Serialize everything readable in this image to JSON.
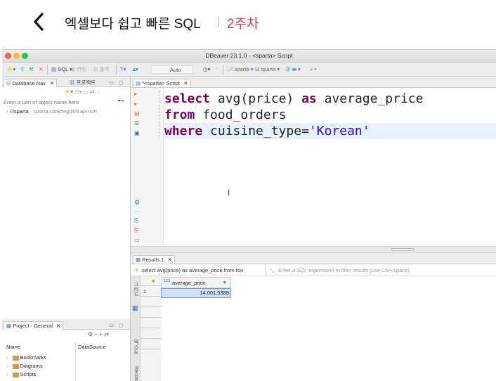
{
  "course": {
    "back_icon": "chevron-left-icon",
    "title": "엑셀보다 쉽고 빠른 SQL",
    "week": "2주차",
    "week_color": "#e8344e"
  },
  "window": {
    "title": "DBeaver 23.1.0 - <sparta> Script",
    "traffic_lights": [
      "#fe5f57",
      "#febc2e",
      "#28c840"
    ]
  },
  "toolbar": {
    "sql_label": "SQL",
    "commit_label": "커밋",
    "rollback_label": "롤백",
    "transaction_mode": "Auto",
    "connection_1": "sparta",
    "connection_2": "sparta"
  },
  "left_panel": {
    "tab_db_nav": "Database Nav",
    "tab_project": "프로젝트",
    "filter_placeholder": "Enter a part of object name here",
    "connection_name": "sparta",
    "connection_host": "- sparta.cbt9ceqjwlr9.ap-nort",
    "project_tab": "Project - General",
    "col_name": "Name",
    "col_datasource": "DataSource",
    "folders": [
      "Bookmarks",
      "Diagrams",
      "Scripts"
    ]
  },
  "editor": {
    "tab_label": "*<sparta> Script",
    "lines": [
      {
        "kw": "select",
        "rest": " avg(price) ",
        "kw2": "as",
        "rest2": " average_price"
      },
      {
        "kw": "from",
        "rest": " food_orders"
      },
      {
        "kw": "where",
        "rest": " cuisine_type=",
        "str": "'Korean'"
      }
    ]
  },
  "results": {
    "tab_label": "Results 1",
    "query_text": "select avg(price) as average_price from foo",
    "filter_placeholder": "Enter a SQL expression to filter results (use Ctrl+Space)",
    "side_tabs": [
      "그리드",
      "텍스트",
      "Record"
    ],
    "column_type": "123",
    "column_name": "average_price",
    "rows": [
      {
        "num": "1",
        "value": "14,001.5385"
      }
    ]
  }
}
